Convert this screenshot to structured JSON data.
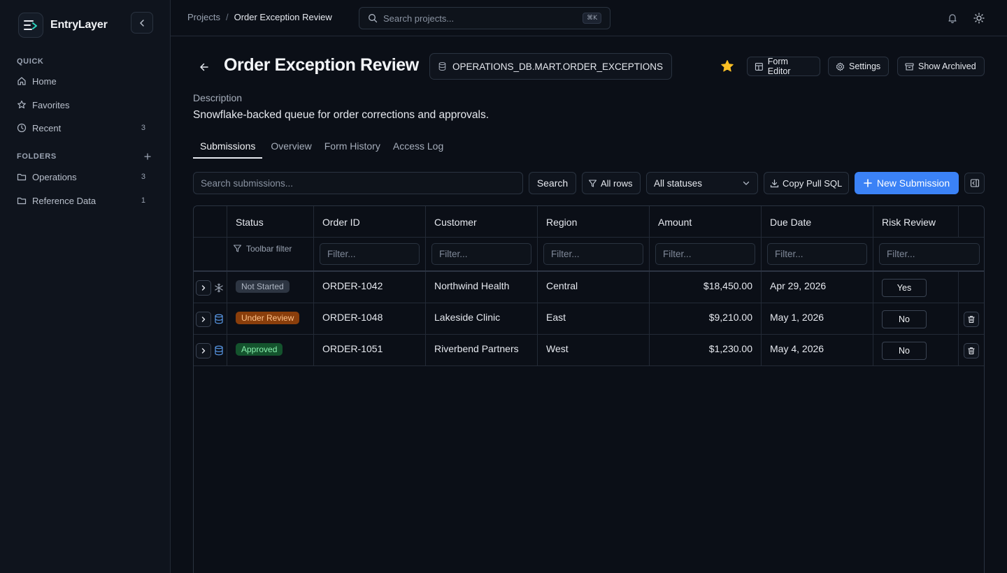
{
  "app": {
    "name": "EntryLayer"
  },
  "sidebar": {
    "quick_label": "QUICK",
    "folders_label": "FOLDERS",
    "quick_items": [
      {
        "label": "Home",
        "icon": "home-icon",
        "count": ""
      },
      {
        "label": "Favorites",
        "icon": "star-icon",
        "count": ""
      },
      {
        "label": "Recent",
        "icon": "clock-icon",
        "count": "3"
      }
    ],
    "folders": [
      {
        "label": "Operations",
        "icon": "folder-icon",
        "count": "3"
      },
      {
        "label": "Reference Data",
        "icon": "folder-icon",
        "count": "1"
      }
    ]
  },
  "topbar": {
    "breadcrumb_root": "Projects",
    "breadcrumb_sep": "/",
    "breadcrumb_current": "Order Exception Review",
    "search_placeholder": "Search projects...",
    "search_shortcut": "⌘K"
  },
  "header": {
    "title": "Order Exception Review",
    "source_table": "OPERATIONS_DB.MART.ORDER_EXCEPTIONS",
    "favorite_color": "#fbbf24",
    "buttons": {
      "form_editor": "Form Editor",
      "settings": "Settings",
      "show_archived": "Show Archived"
    }
  },
  "description": {
    "label": "Description",
    "text": "Snowflake-backed queue for order corrections and approvals."
  },
  "tabs": [
    {
      "label": "Submissions",
      "active": true
    },
    {
      "label": "Overview",
      "active": false
    },
    {
      "label": "Form History",
      "active": false
    },
    {
      "label": "Access Log",
      "active": false
    }
  ],
  "toolbar": {
    "search_placeholder": "Search submissions...",
    "search_button": "Search",
    "row_filter": "All rows",
    "status_select": "All statuses",
    "copy_sql": "Copy Pull SQL",
    "new_submission": "New Submission",
    "accent_color": "#3b82f6"
  },
  "table": {
    "columns": [
      "Status",
      "Order ID",
      "Customer",
      "Region",
      "Amount",
      "Due Date",
      "Risk Review"
    ],
    "filter_placeholder": "Filter...",
    "status_filter_label": "Toolbar filter",
    "rows": [
      {
        "source": "snowflake-icon",
        "status": "Not Started",
        "order_id": "ORDER-1042",
        "customer": "Northwind Health",
        "region": "Central",
        "amount": "$18,450.00",
        "due_date": "Apr 29, 2026",
        "risk_review": "Yes",
        "deletable": false
      },
      {
        "source": "database-icon",
        "status": "Under Review",
        "order_id": "ORDER-1048",
        "customer": "Lakeside Clinic",
        "region": "East",
        "amount": "$9,210.00",
        "due_date": "May 1, 2026",
        "risk_review": "No",
        "deletable": true
      },
      {
        "source": "database-icon",
        "status": "Approved",
        "order_id": "ORDER-1051",
        "customer": "Riverbend Partners",
        "region": "West",
        "amount": "$1,230.00",
        "due_date": "May 4, 2026",
        "risk_review": "No",
        "deletable": true
      }
    ]
  }
}
